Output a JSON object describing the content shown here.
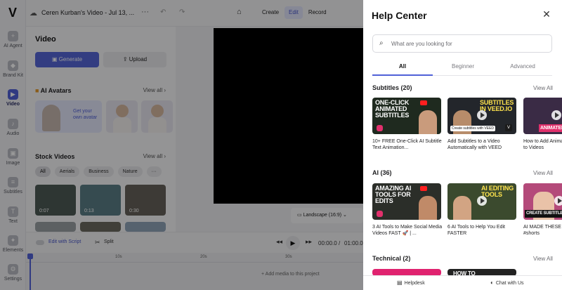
{
  "editor": {
    "logo": "V",
    "project_title": "Ceren Kurban's Video - Jul 13, ...",
    "icons": {
      "cloud": "cloud-icon",
      "more": "more-dots-icon",
      "undo": "undo-icon",
      "redo": "redo-icon",
      "home": "home-icon"
    },
    "modes": [
      {
        "label": "Create",
        "active": false
      },
      {
        "label": "Edit",
        "active": true
      },
      {
        "label": "Record",
        "active": false
      }
    ],
    "rail": [
      {
        "label": "AI Agent",
        "icon": "plus-icon"
      },
      {
        "label": "Brand Kit",
        "icon": "brand-icon"
      },
      {
        "label": "Video",
        "icon": "video-icon",
        "active": true
      },
      {
        "label": "Audio",
        "icon": "music-icon"
      },
      {
        "label": "Image",
        "icon": "image-icon"
      },
      {
        "label": "Subtitles",
        "icon": "subtitles-icon"
      },
      {
        "label": "Text",
        "icon": "text-icon"
      },
      {
        "label": "Elements",
        "icon": "elements-icon"
      },
      {
        "label": "Settings",
        "icon": "gear-icon"
      }
    ],
    "panel": {
      "title": "Video",
      "generate_label": "Generate",
      "upload_label": "Upload",
      "ai_avatars": {
        "title": "AI Avatars",
        "view_all": "View all",
        "promo": "Get your own avatar"
      },
      "stock_videos": {
        "title": "Stock Videos",
        "view_all": "View all"
      },
      "chips": [
        "All",
        "Aerials",
        "Business",
        "Nature",
        "···"
      ],
      "thumbs": [
        {
          "duration": "0:07",
          "color": "#4d5a55"
        },
        {
          "duration": "0:13",
          "color": "#5b7e86"
        },
        {
          "duration": "0:30",
          "color": "#66625a"
        }
      ]
    },
    "stage": {
      "aspect_label": "Landscape (16:9)"
    },
    "controls": {
      "edit_with_script": "Edit with Script",
      "split": "Split",
      "current_time": "00:00.0",
      "separator": "/",
      "total_time": "01:00.0"
    },
    "timeline": {
      "ticks": [
        "10s",
        "20s",
        "30s",
        "40s"
      ],
      "add_media": "+ Add media to this project"
    }
  },
  "help": {
    "title": "Help Center",
    "close_icon": "close-icon",
    "search_placeholder": "What are you looking for",
    "tabs": [
      {
        "label": "All",
        "active": true
      },
      {
        "label": "Beginner",
        "active": false
      },
      {
        "label": "Advanced",
        "active": false
      }
    ],
    "sections": [
      {
        "title": "Subtitles (20)",
        "view_all": "View All",
        "cards": [
          {
            "title": "10+ FREE One-Click AI Subtitle Text Animation...",
            "thumb_text": "ONE-CLICK ANIMATED SUBTITLES",
            "color": "#1f2a1f"
          },
          {
            "title": "Add Subtitles to a Video Automatically with VEED",
            "thumb_text": "SUBTITLES IN VEED.IO",
            "badge": "Create subtitles with VEED",
            "color": "#23262b"
          },
          {
            "title": "How to Add Animated Subtitles to Videos",
            "thumb_text": "ANIMATED",
            "color": "#3a2b45"
          }
        ]
      },
      {
        "title": "AI (36)",
        "view_all": "View All",
        "cards": [
          {
            "title": "3 AI Tools to Make Social Media Videos FAST 🚀 | ...",
            "thumb_text": "AMAZING AI TOOLS FOR EDITS",
            "color": "#2b2e29"
          },
          {
            "title": "6 AI Tools to Help You Edit FASTER",
            "thumb_text": "AI EDITING TOOLS",
            "color": "#3b4a2e"
          },
          {
            "title": "AI MADE THESE SUBTITLES! #shorts",
            "thumb_text": "CREATE SUBTITLES",
            "color": "#b44a7a"
          }
        ]
      },
      {
        "title": "Technical (2)",
        "view_all": "View All",
        "cards": [
          {
            "title": "",
            "thumb_text": "",
            "color": "#e0226f"
          },
          {
            "title": "",
            "thumb_text": "HOW TO",
            "color": "#222222"
          }
        ]
      }
    ],
    "footer": {
      "helpdesk": "Helpdesk",
      "chat": "Chat with Us"
    }
  }
}
